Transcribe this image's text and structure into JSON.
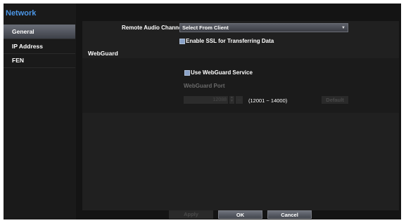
{
  "sidebar": {
    "title": "Network",
    "items": [
      {
        "label": "General",
        "active": true
      },
      {
        "label": "IP Address",
        "active": false
      },
      {
        "label": "FEN",
        "active": false
      }
    ]
  },
  "form": {
    "remote_audio_label": "Remote Audio Channel",
    "remote_audio_value": "Select From Client",
    "ssl_label": "Enable SSL for Transferring Data",
    "webguard_section": "WebGuard",
    "use_webguard_label": "Use WebGuard Service",
    "webguard_port_label": "WebGuard Port",
    "webguard_port_value": "12088",
    "webguard_port_range": "(12001 ~ 14000)",
    "default_button": "Default"
  },
  "footer": {
    "apply_button": "Apply",
    "ok_button": "OK",
    "cancel_button": "Cancel"
  },
  "colors": {
    "accent": "#4b96e6",
    "background": "#141414",
    "panel": "#202020"
  }
}
